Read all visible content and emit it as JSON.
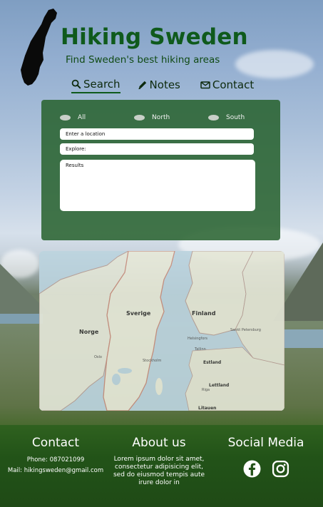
{
  "header": {
    "title": "Hiking Sweden",
    "subtitle": "Find Sweden's best hiking areas"
  },
  "nav": {
    "items": [
      {
        "label": "Search",
        "icon": "search-icon"
      },
      {
        "label": "Notes",
        "icon": "pencil-icon"
      },
      {
        "label": "Contact",
        "icon": "envelope-icon"
      }
    ],
    "active": "Search"
  },
  "search": {
    "regions": [
      "All",
      "North",
      "South"
    ],
    "location_placeholder": "Enter a location",
    "explore_placeholder": "Explore:",
    "results_label": "Results"
  },
  "map": {
    "labels": {
      "sweden": "Sverige",
      "norway": "Norge",
      "finland": "Finland",
      "estonia": "Estland",
      "latvia": "Lettland",
      "lithuania": "Litauen",
      "oslo": "Oslo",
      "stockholm": "Stockholm",
      "helsinki": "Helsingfors",
      "tallinn": "Tallinn",
      "riga": "Riga",
      "st_petersburg": "Sankt Petersburg"
    }
  },
  "footer": {
    "contact": {
      "title": "Contact",
      "phone": "Phone: 087021099",
      "mail": "Mail: hikingsweden@gmail.com"
    },
    "about": {
      "title": "About us",
      "text": "Lorem ipsum dolor sit amet, consectetur adipisicing elit, sed do eiusmod tempis aute irure dolor in"
    },
    "social": {
      "title": "Social Media",
      "icons": [
        "facebook-icon",
        "instagram-icon"
      ]
    }
  },
  "colors": {
    "brand_green": "#0f5a1c",
    "panel_green": "#26602c",
    "footer_green": "#245219"
  }
}
